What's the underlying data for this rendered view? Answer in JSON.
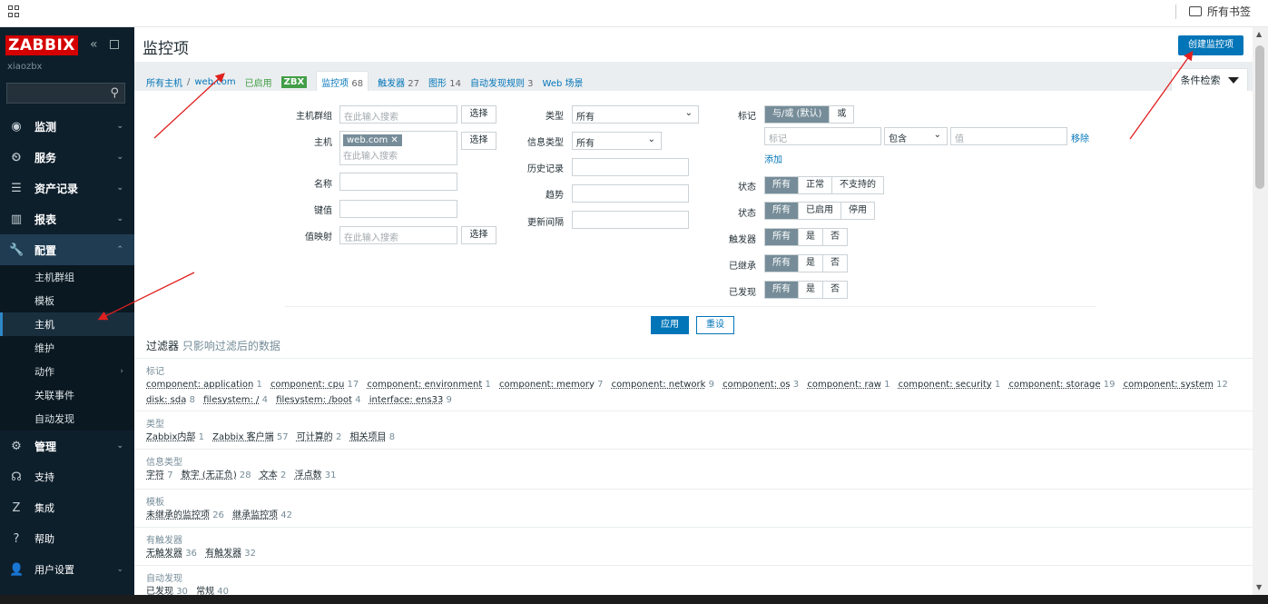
{
  "browser": {
    "bookmarks_label": "所有书签"
  },
  "sidebar": {
    "logo": "ZABBIX",
    "server": "xiaozbx",
    "menu": [
      {
        "label": "监测",
        "icon": "eye-icon"
      },
      {
        "label": "服务",
        "icon": "clock-icon"
      },
      {
        "label": "资产记录",
        "icon": "list-icon"
      },
      {
        "label": "报表",
        "icon": "chart-icon"
      },
      {
        "label": "配置",
        "icon": "wrench-icon"
      }
    ],
    "config_sub": [
      "主机群组",
      "模板",
      "主机",
      "维护",
      "动作",
      "关联事件",
      "自动发现"
    ],
    "admin": {
      "label": "管理",
      "icon": "gear-icon"
    },
    "bottom": [
      {
        "label": "支持",
        "icon": "headset-icon"
      },
      {
        "label": "集成",
        "icon": "zabbix-z-icon"
      },
      {
        "label": "帮助",
        "icon": "question-icon"
      },
      {
        "label": "用户设置",
        "icon": "user-icon"
      }
    ]
  },
  "header": {
    "title": "监控项",
    "create_button": "创建监控项"
  },
  "nav": {
    "all_hosts": "所有主机",
    "host": "web.com",
    "enabled": "已启用",
    "zbx": "ZBX",
    "items": "监控项",
    "items_count": "68",
    "triggers": "触发器",
    "triggers_count": "27",
    "graphs": "图形",
    "graphs_count": "14",
    "discovery": "自动发现规则",
    "discovery_count": "3",
    "web": "Web 场景",
    "filter_tab": "条件检索"
  },
  "filter": {
    "hostgroups_label": "主机群组",
    "search_placeholder": "在此输入搜索",
    "select_button": "选择",
    "host_label": "主机",
    "host_chip": "web.com",
    "name_label": "名称",
    "key_label": "键值",
    "valuemap_label": "值映射",
    "type_label": "类型",
    "type_value": "所有",
    "infotype_label": "信息类型",
    "infotype_value": "所有",
    "history_label": "历史记录",
    "trends_label": "趋势",
    "interval_label": "更新间隔",
    "tags_label": "标记",
    "tags_andor": "与/或 (默认)",
    "tags_or": "或",
    "tag_placeholder": "标记",
    "tag_op": "包含",
    "value_placeholder": "值",
    "remove": "移除",
    "add": "添加",
    "state_label": "状态",
    "state_opts": [
      "所有",
      "正常",
      "不支持的"
    ],
    "status_label": "状态",
    "status_opts": [
      "所有",
      "已启用",
      "停用"
    ],
    "triggers_label": "触发器",
    "inherited_label": "已继承",
    "discovered_label": "已发现",
    "yes_no": [
      "所有",
      "是",
      "否"
    ],
    "apply": "应用",
    "reset": "重设"
  },
  "subfilter": {
    "title": "过滤器",
    "hint": "只影响过滤后的数据",
    "groups": [
      {
        "title": "标记",
        "items": [
          [
            "component: application",
            "1"
          ],
          [
            "component: cpu",
            "17"
          ],
          [
            "component: environment",
            "1"
          ],
          [
            "component: memory",
            "7"
          ],
          [
            "component: network",
            "9"
          ],
          [
            "component: os",
            "3"
          ],
          [
            "component: raw",
            "1"
          ],
          [
            "component: security",
            "1"
          ],
          [
            "component: storage",
            "19"
          ],
          [
            "component: system",
            "12"
          ],
          [
            "disk: sda",
            "8"
          ],
          [
            "filesystem: /",
            "4"
          ],
          [
            "filesystem: /boot",
            "4"
          ],
          [
            "interface: ens33",
            "9"
          ]
        ]
      },
      {
        "title": "类型",
        "items": [
          [
            "Zabbix内部",
            "1"
          ],
          [
            "Zabbix 客户端",
            "57"
          ],
          [
            "可计算的",
            "2"
          ],
          [
            "相关项目",
            "8"
          ]
        ]
      },
      {
        "title": "信息类型",
        "items": [
          [
            "字符",
            "7"
          ],
          [
            "数字 (无正负)",
            "28"
          ],
          [
            "文本",
            "2"
          ],
          [
            "浮点数",
            "31"
          ]
        ]
      },
      {
        "title": "模板",
        "items": [
          [
            "未继承的监控项",
            "26"
          ],
          [
            "继承监控项",
            "42"
          ]
        ]
      },
      {
        "title": "有触发器",
        "items": [
          [
            "无触发器",
            "36"
          ],
          [
            "有触发器",
            "32"
          ]
        ]
      },
      {
        "title": "自动发现",
        "items": [
          [
            "已发现",
            "30"
          ],
          [
            "常规",
            "40"
          ]
        ]
      }
    ]
  }
}
